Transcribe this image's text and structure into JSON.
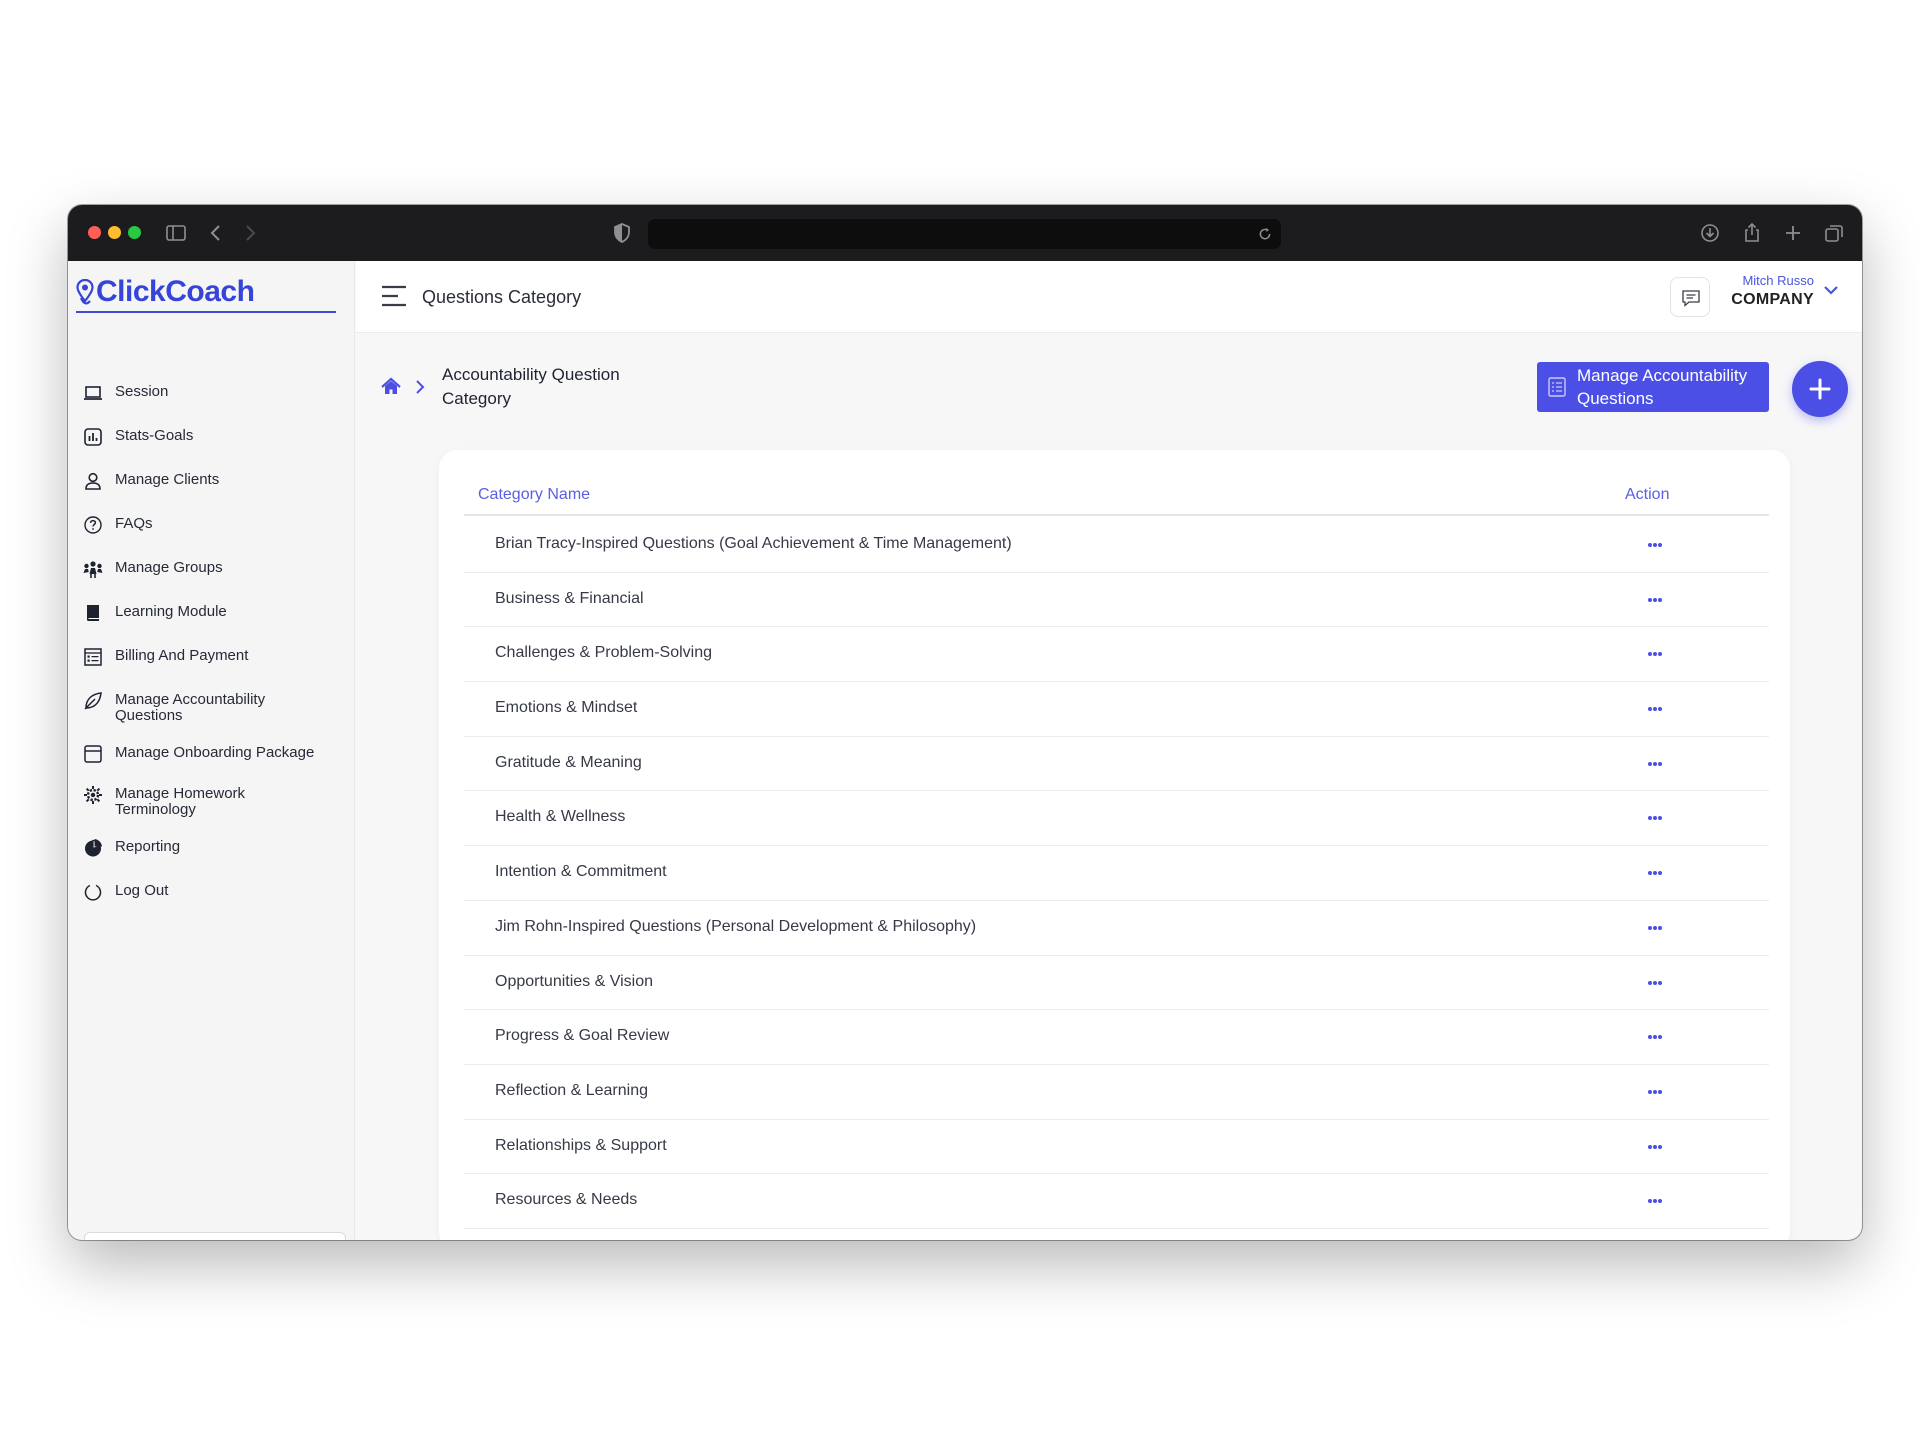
{
  "app": {
    "brand": "ClickCoach",
    "page_title": "Questions Category",
    "accent": "#4b4fe6"
  },
  "user": {
    "name": "Mitch Russo",
    "role": "COMPANY"
  },
  "sidebar": {
    "items": [
      {
        "label": "Session",
        "icon": "laptop-icon"
      },
      {
        "label": "Stats-Goals",
        "icon": "chart-icon"
      },
      {
        "label": "Manage Clients",
        "icon": "user-icon"
      },
      {
        "label": "FAQs",
        "icon": "question-icon"
      },
      {
        "label": "Manage Groups",
        "icon": "group-icon"
      },
      {
        "label": "Learning Module",
        "icon": "book-icon"
      },
      {
        "label": "Billing And Payment",
        "icon": "invoice-icon"
      },
      {
        "label": "Manage Accountability Questions",
        "icon": "leaf-icon"
      },
      {
        "label": "Manage Onboarding Package",
        "icon": "package-icon"
      },
      {
        "label": "Manage Homework Terminology",
        "icon": "gear-icon"
      },
      {
        "label": "Reporting",
        "icon": "pie-chart-icon"
      },
      {
        "label": "Log Out",
        "icon": "logout-icon"
      }
    ]
  },
  "breadcrumb": {
    "current": "Accountability Question Category"
  },
  "actions": {
    "manage_label": "Manage Accountability Questions",
    "add_icon": "plus-icon"
  },
  "table": {
    "columns": [
      "Category Name",
      "Action"
    ],
    "rows": [
      "Brian Tracy-Inspired Questions (Goal Achievement & Time Management)",
      "Business & Financial",
      "Challenges & Problem-Solving",
      "Emotions & Mindset",
      "Gratitude & Meaning",
      "Health & Wellness",
      "Intention & Commitment",
      "Jim Rohn-Inspired Questions (Personal Development & Philosophy)",
      "Opportunities & Vision",
      "Progress & Goal Review",
      "Reflection & Learning",
      "Relationships & Support",
      "Resources & Needs"
    ]
  }
}
